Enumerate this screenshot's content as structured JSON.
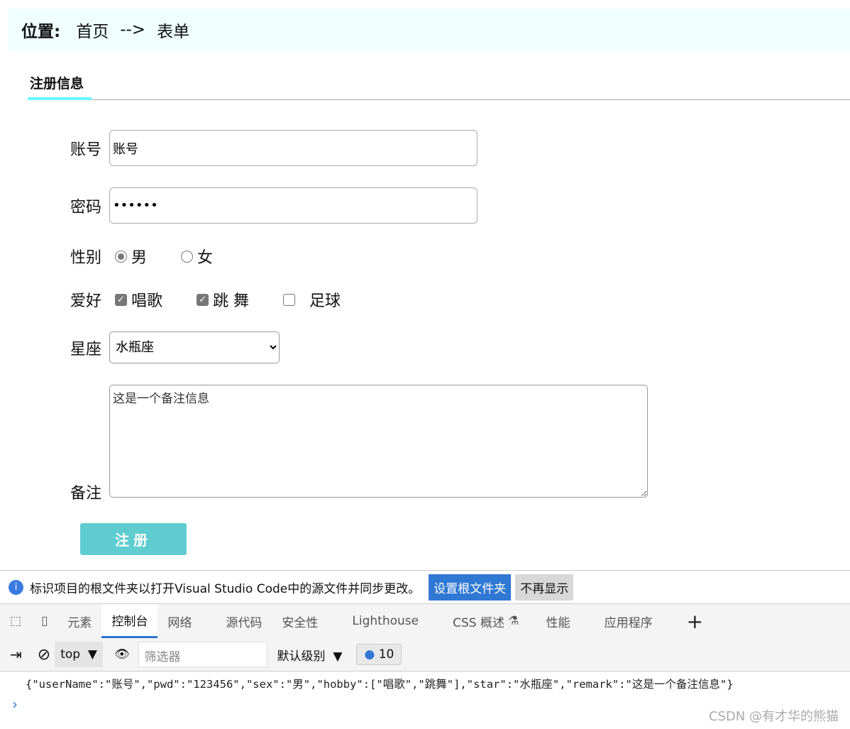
{
  "breadcrumb": {
    "label": "位置:",
    "home": "首页",
    "arrow": "-->",
    "current": "表单"
  },
  "tab": {
    "title": "注册信息"
  },
  "form": {
    "account": {
      "label": "账号",
      "value": "账号"
    },
    "password": {
      "label": "密码",
      "value": "123456"
    },
    "sex": {
      "label": "性别",
      "options": [
        {
          "label": "男",
          "checked": true
        },
        {
          "label": "女",
          "checked": false
        }
      ]
    },
    "hobby": {
      "label": "爱好",
      "options": [
        {
          "label": "唱歌",
          "checked": true
        },
        {
          "label": "跳 舞",
          "checked": true
        },
        {
          "label": "足球",
          "checked": false
        }
      ]
    },
    "star": {
      "label": "星座",
      "value": "水瓶座"
    },
    "remark": {
      "label": "备注",
      "value": "这是一个备注信息"
    },
    "submit": "注册"
  },
  "devtools": {
    "notice": {
      "text": "标识项目的根文件夹以打开Visual Studio Code中的源文件并同步更改。",
      "primary": "设置根文件夹",
      "secondary": "不再显示"
    },
    "tabs": [
      "元素",
      "控制台",
      "网络",
      "源代码",
      "安全性",
      "Lighthouse",
      "CSS 概述",
      "性能",
      "应用程序"
    ],
    "active_tab": "控制台",
    "toolbar": {
      "context": "top",
      "filter_placeholder": "筛选器",
      "level": "默认级别",
      "message_count": "10"
    },
    "log": "{\"userName\":\"账号\",\"pwd\":\"123456\",\"sex\":\"男\",\"hobby\":[\"唱歌\",\"跳舞\"],\"star\":\"水瓶座\",\"remark\":\"这是一个备注信息\"}"
  },
  "watermark": "CSDN @有才华的熊猫",
  "colors": {
    "accent": "#5fccd0",
    "breadcrumb_bg": "#f0ffff",
    "tab_underline": "#66ffff",
    "devtools_blue": "#2f78d4"
  }
}
